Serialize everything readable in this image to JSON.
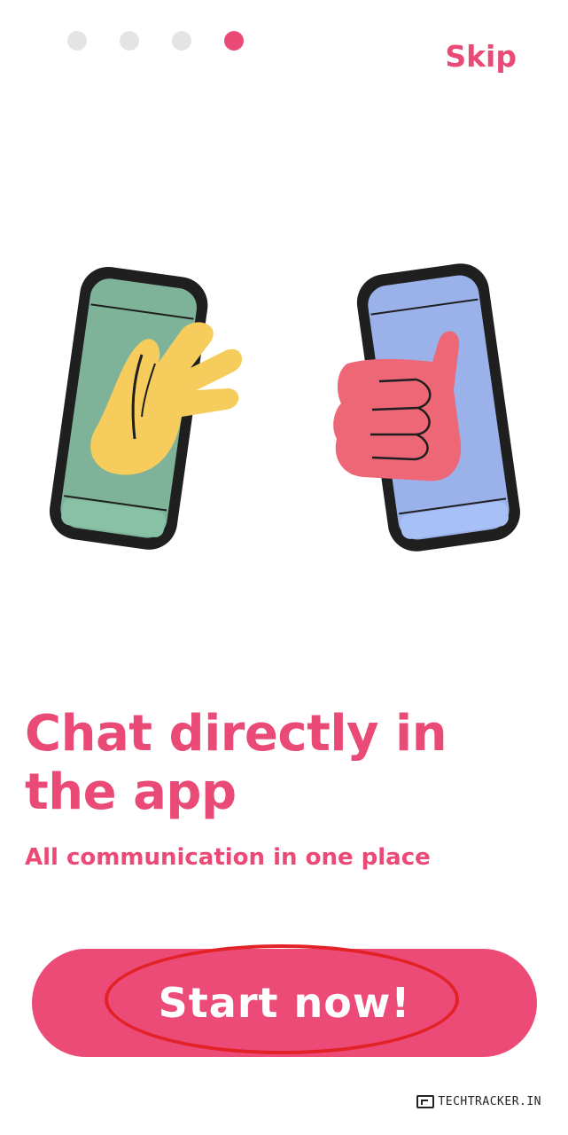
{
  "pager": {
    "total": 4,
    "current": 4
  },
  "header": {
    "skip_label": "Skip"
  },
  "illustration": {
    "left_phone_color": "#7eb39a",
    "right_phone_color": "#9ab1ea",
    "wave_hand_color": "#f6cd5d",
    "thumbs_hand_color": "#ee6777"
  },
  "content": {
    "headline": "Chat directly in the app",
    "subtitle": "All communication in one place"
  },
  "cta": {
    "label": "Start now!"
  },
  "watermark": {
    "text": "TECHTRACKER.IN"
  },
  "colors": {
    "accent": "#ea4a76",
    "inactive_dot": "#e4e4e4",
    "annotation": "#e32227"
  }
}
